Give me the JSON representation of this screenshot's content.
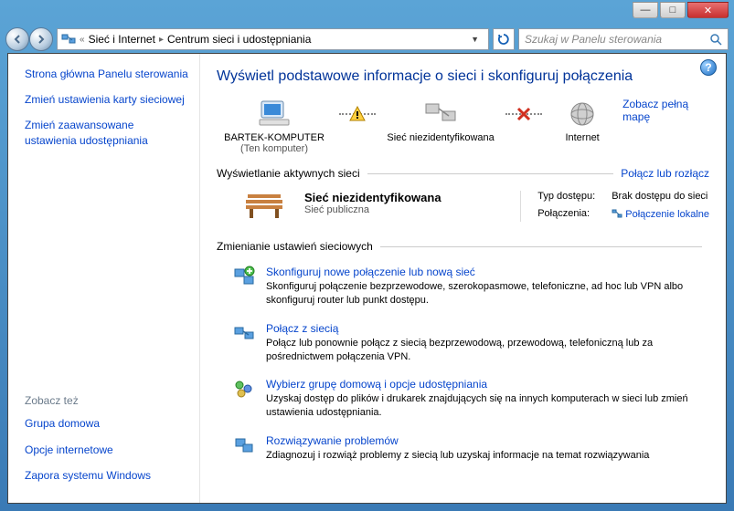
{
  "window": {
    "minimize": "—",
    "maximize": "□",
    "close": "✕"
  },
  "breadcrumb": {
    "item1": "Sieć i Internet",
    "item2": "Centrum sieci i udostępniania"
  },
  "search": {
    "placeholder": "Szukaj w Panelu sterowania"
  },
  "sidebar": {
    "home": "Strona główna Panelu sterowania",
    "adapter": "Zmień ustawienia karty sieciowej",
    "sharing": "Zmień zaawansowane ustawienia udostępniania",
    "see_also_hdr": "Zobacz też",
    "homegroup": "Grupa domowa",
    "inet_options": "Opcje internetowe",
    "firewall": "Zapora systemu Windows"
  },
  "main": {
    "title": "Wyświetl podstawowe informacje o sieci i skonfiguruj połączenia",
    "full_map": "Zobacz pełną mapę",
    "node_computer": "BARTEK-KOMPUTER",
    "node_computer_sub": "(Ten komputer)",
    "node_unidentified": "Sieć niezidentyfikowana",
    "node_internet": "Internet",
    "active_hdr": "Wyświetlanie aktywnych sieci",
    "connect_disconnect": "Połącz lub rozłącz",
    "net_name": "Sieć niezidentyfikowana",
    "net_type": "Sieć publiczna",
    "access_label": "Typ dostępu:",
    "access_value": "Brak dostępu do sieci",
    "conn_label": "Połączenia:",
    "conn_value": "Połączenie lokalne",
    "settings_hdr": "Zmienianie ustawień sieciowych",
    "tasks": [
      {
        "title": "Skonfiguruj nowe połączenie lub nową sieć",
        "desc": "Skonfiguruj połączenie bezprzewodowe, szerokopasmowe, telefoniczne, ad hoc lub VPN albo skonfiguruj router lub punkt dostępu."
      },
      {
        "title": "Połącz z siecią",
        "desc": "Połącz lub ponownie połącz z siecią bezprzewodową, przewodową, telefoniczną lub za pośrednictwem połączenia VPN."
      },
      {
        "title": "Wybierz grupę domową i opcje udostępniania",
        "desc": "Uzyskaj dostęp do plików i drukarek znajdujących się na innych komputerach w sieci lub zmień ustawienia udostępniania."
      },
      {
        "title": "Rozwiązywanie problemów",
        "desc": "Zdiagnozuj i rozwiąż problemy z siecią lub uzyskaj informacje na temat rozwiązywania"
      }
    ]
  }
}
